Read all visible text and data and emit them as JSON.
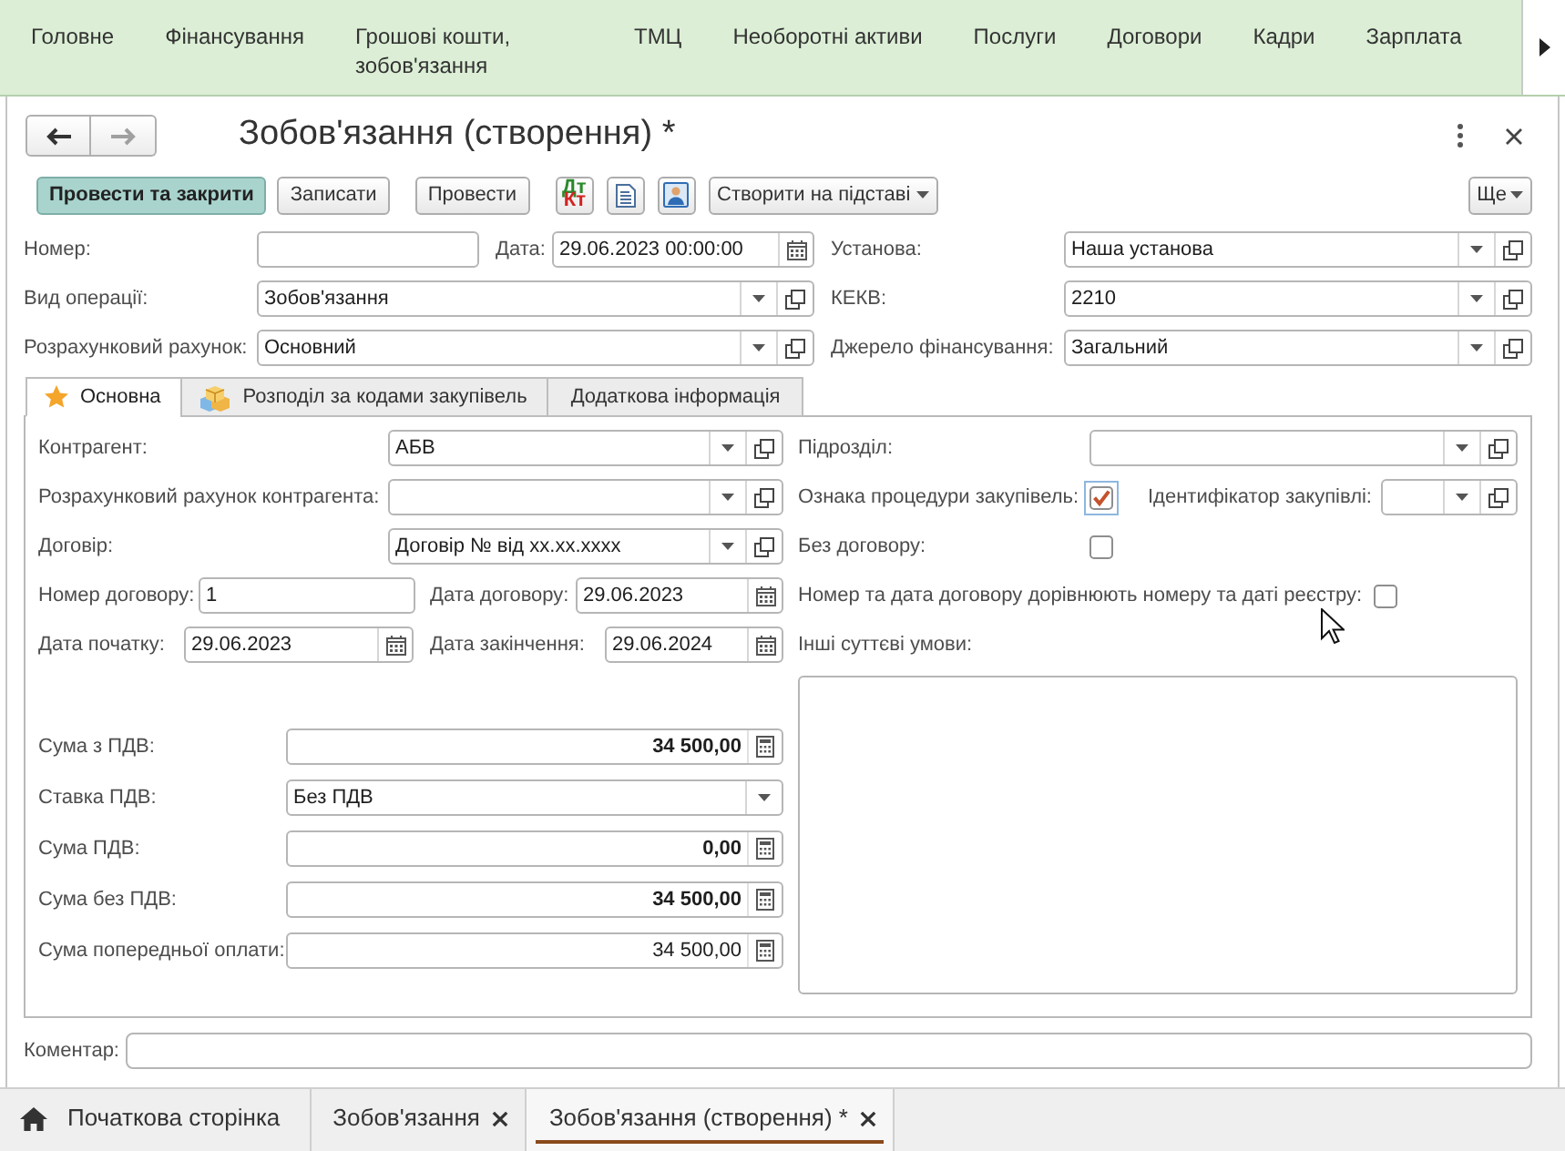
{
  "top_menu": {
    "items": [
      "Головне",
      "Фінансування",
      "Грошові кошти, зобов'язання",
      "ТМЦ",
      "Необоротні активи",
      "Послуги",
      "Договори",
      "Кадри",
      "Зарплата"
    ]
  },
  "nav": {
    "back": {
      "disabled": false
    },
    "forward": {
      "disabled": true
    }
  },
  "window": {
    "title": "Зобов'язання (створення) *"
  },
  "toolbar": [
    {
      "kind": "button",
      "label": "Провести та закрити",
      "default": true
    },
    {
      "kind": "button",
      "label": "Записати",
      "default": false
    },
    {
      "kind": "button",
      "label": "Провести",
      "default": false
    },
    {
      "kind": "dtkt",
      "debit": "Дт",
      "credit": "Кт"
    },
    {
      "kind": "report"
    },
    {
      "kind": "card"
    },
    {
      "kind": "menu",
      "label": "Створити на підставі"
    }
  ],
  "more_menu": {
    "label": "Ще"
  },
  "header": {
    "number": {
      "label": "Номер:"
    },
    "date": {
      "label": "Дата:",
      "value": "29.06.2023 00:00:00"
    },
    "institution": {
      "label": "Установа:",
      "value": "Наша установа"
    },
    "operation_type": {
      "label": "Вид операції:",
      "value": "Зобов'язання"
    },
    "kekv": {
      "label": "КЕКВ:",
      "value": "2210"
    },
    "account": {
      "label": "Розрахунковий рахунок:",
      "value": "Основний"
    },
    "funding_source": {
      "label": "Джерело фінансування:",
      "value": "Загальний"
    }
  },
  "tabs": [
    {
      "label": "Основна",
      "selected": true
    },
    {
      "label": "Розподіл за кодами закупівель",
      "selected": false
    },
    {
      "label": "Додаткова інформація",
      "selected": false
    }
  ],
  "main_tab": {
    "counterparty": {
      "label": "Контрагент:",
      "value": "АБВ"
    },
    "counterparty_account": {
      "label": "Розрахунковий рахунок контрагента:"
    },
    "contract": {
      "label": "Договір:",
      "value": "Договір № від xx.xx.xxxx"
    },
    "contract_number": {
      "label": "Номер договору:",
      "value": "1"
    },
    "contract_date": {
      "label": "Дата договору:",
      "value": "29.06.2023"
    },
    "start_date": {
      "label": "Дата початку:",
      "value": "29.06.2023"
    },
    "end_date": {
      "label": "Дата закінчення:",
      "value": "29.06.2024"
    },
    "amounts": [
      {
        "kind": "number",
        "label": "Сума з ПДВ:",
        "value": "34 500,00",
        "bold": true
      },
      {
        "kind": "select",
        "label": "Ставка ПДВ:",
        "value": "Без ПДВ"
      },
      {
        "kind": "number",
        "label": "Сума ПДВ:",
        "value": "0,00",
        "bold": true
      },
      {
        "kind": "number",
        "label": "Сума без ПДВ:",
        "value": "34 500,00",
        "bold": true
      },
      {
        "kind": "number",
        "label": "Сума попередньої оплати:",
        "value": "34 500,00",
        "bold": false
      }
    ],
    "subdivision": {
      "label": "Підрозділ:"
    },
    "procurement_procedure": {
      "label": "Ознака процедури закупівель:",
      "checked": true,
      "focused": true
    },
    "procurement_id": {
      "label": "Ідентифікатор закупівлі:"
    },
    "no_contract": {
      "label": "Без договору:",
      "checked": false,
      "focused": false
    },
    "registry_match": {
      "label": "Номер та дата договору дорівнюють номеру та даті реєстру:",
      "checked": false,
      "focused": false
    },
    "other_terms": {
      "label": "Інші суттєві умови:"
    }
  },
  "comment": {
    "label": "Коментар:"
  },
  "open_tabs": [
    {
      "kind": "home",
      "label": "Початкова сторінка",
      "selected": false
    },
    {
      "kind": "document",
      "label": "Зобов'язання",
      "selected": false
    },
    {
      "kind": "document",
      "label": "Зобов'язання (створення) *",
      "selected": true
    }
  ]
}
